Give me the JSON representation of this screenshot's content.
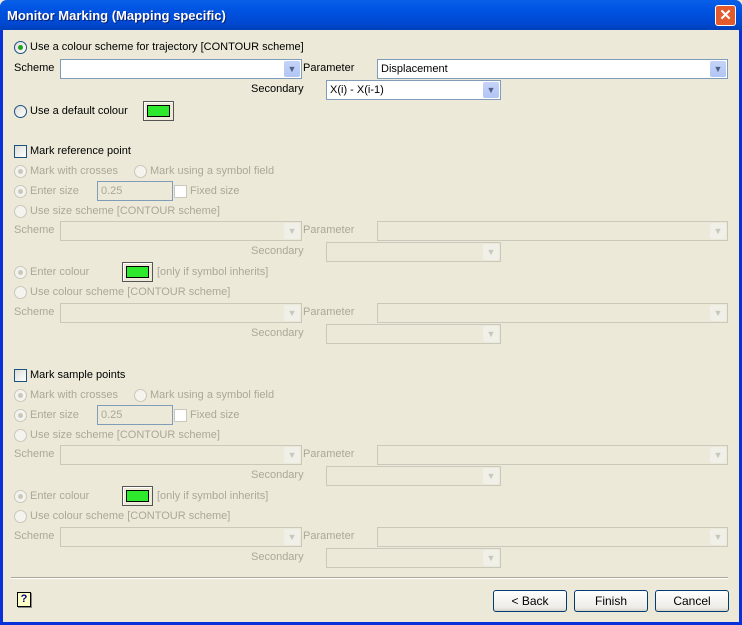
{
  "window": {
    "title": "Monitor Marking (Mapping specific)",
    "close_icon": "close-icon"
  },
  "trajectory": {
    "scheme_radio_label": "Use a colour scheme for trajectory [CONTOUR scheme]",
    "scheme_label": "Scheme",
    "scheme_value": "",
    "parameter_label": "Parameter",
    "parameter_value": "Displacement",
    "secondary_label": "Secondary",
    "secondary_value": "X(i) - X(i-1)",
    "default_colour_label": "Use a default colour",
    "default_colour": "#2EE82E"
  },
  "reference": {
    "checkbox_label": "Mark reference point",
    "checked": false,
    "crosses_label": "Mark with crosses",
    "symbol_label": "Mark using a symbol field",
    "enter_size_label": "Enter size",
    "size_value": "0.25",
    "fixed_size_label": "Fixed size",
    "size_scheme_label": "Use size scheme [CONTOUR scheme]",
    "scheme_label": "Scheme",
    "parameter_label": "Parameter",
    "secondary_label": "Secondary",
    "enter_colour_label": "Enter colour",
    "colour_note": "[only if symbol inherits]",
    "colour_scheme_label": "Use colour scheme [CONTOUR scheme]",
    "scheme2_label": "Scheme",
    "parameter2_label": "Parameter",
    "secondary2_label": "Secondary"
  },
  "sample": {
    "checkbox_label": "Mark sample points",
    "checked": false,
    "crosses_label": "Mark with crosses",
    "symbol_label": "Mark using a symbol field",
    "enter_size_label": "Enter size",
    "size_value": "0.25",
    "fixed_size_label": "Fixed size",
    "size_scheme_label": "Use size scheme [CONTOUR scheme]",
    "scheme_label": "Scheme",
    "parameter_label": "Parameter",
    "secondary_label": "Secondary",
    "enter_colour_label": "Enter colour",
    "colour_note": "[only if symbol inherits]",
    "colour_scheme_label": "Use colour scheme [CONTOUR scheme]",
    "scheme2_label": "Scheme",
    "parameter2_label": "Parameter",
    "secondary2_label": "Secondary"
  },
  "footer": {
    "help_icon": "?",
    "back_label": "< Back",
    "finish_label": "Finish",
    "cancel_label": "Cancel"
  }
}
